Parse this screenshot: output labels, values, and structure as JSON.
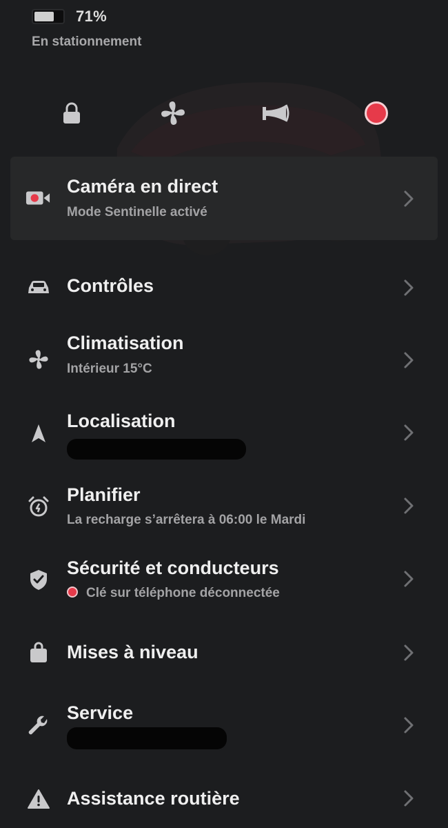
{
  "status": {
    "battery_percent": "71%",
    "battery_level": 0.71,
    "car_state": "En stationnement"
  },
  "quick_controls": [
    {
      "name": "lock",
      "icon": "lock-icon"
    },
    {
      "name": "fan",
      "icon": "fan-icon"
    },
    {
      "name": "horn",
      "icon": "horn-icon"
    },
    {
      "name": "sentry-record",
      "icon": "record-icon"
    }
  ],
  "live_camera": {
    "title": "Caméra en direct",
    "subtitle": "Mode Sentinelle activé",
    "icon": "camera-record-icon"
  },
  "menu": {
    "controls": {
      "title": "Contrôles",
      "icon": "car-icon"
    },
    "climate": {
      "title": "Climatisation",
      "subtitle": "Intérieur 15°C",
      "icon": "fan-icon"
    },
    "location": {
      "title": "Localisation",
      "icon": "navigation-arrow-icon"
    },
    "schedule": {
      "title": "Planifier",
      "subtitle": "La recharge s’arrêtera à 06:00 le Mardi",
      "icon": "alarm-clock-icon"
    },
    "security": {
      "title": "Sécurité et conducteurs",
      "subtitle": "Clé sur téléphone déconnectée",
      "icon": "shield-check-icon"
    },
    "upgrades": {
      "title": "Mises à niveau",
      "icon": "shopping-bag-icon"
    },
    "service": {
      "title": "Service",
      "icon": "wrench-icon"
    },
    "roadside": {
      "title": "Assistance routière",
      "icon": "warning-triangle-icon"
    }
  },
  "colors": {
    "background": "#1c1d1f",
    "card": "#272829",
    "accent_red": "#e63a4a",
    "text_primary": "#efefef",
    "text_secondary": "#a3a3a5",
    "icon": "#c9c9cb",
    "chevron": "#6f7073"
  }
}
